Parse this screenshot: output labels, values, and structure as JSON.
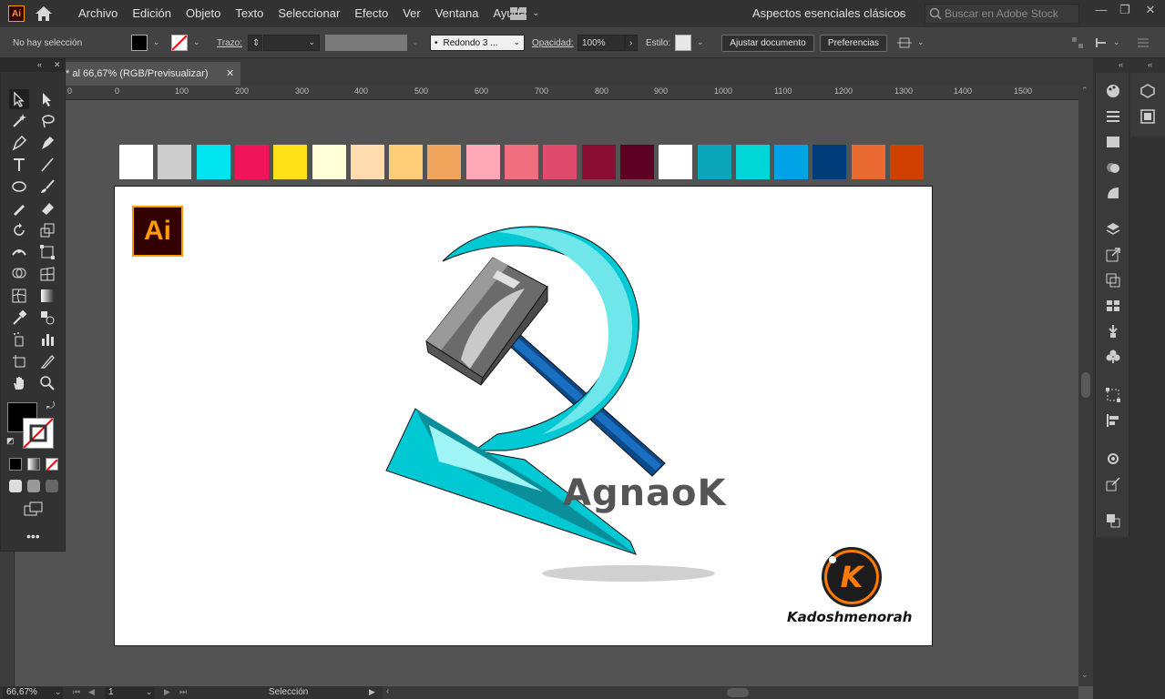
{
  "app": {
    "logo_text": "Ai",
    "menus": [
      "Archivo",
      "Edición",
      "Objeto",
      "Texto",
      "Seleccionar",
      "Efecto",
      "Ver",
      "Ventana",
      "Ayuda"
    ],
    "workspace": "Aspectos esenciales clásicos",
    "search_placeholder": "Buscar en Adobe Stock"
  },
  "control_bar": {
    "selection": "No hay selección",
    "stroke_label": "Trazo:",
    "brush_value": "Redondo 3 ...",
    "opacity_label": "Opacidad:",
    "opacity_value": "100%",
    "style_label": "Estilo:",
    "adjust_doc": "Ajustar documento",
    "preferences": "Preferencias"
  },
  "document": {
    "tab_title": "* al 66,67% (RGB/Previsualizar)",
    "tab_close": "✕"
  },
  "ruler_ticks": [
    "0",
    "0",
    "100",
    "200",
    "300",
    "400",
    "500",
    "600",
    "700",
    "800",
    "900",
    "1000",
    "1100",
    "1200",
    "1300",
    "1400",
    "1500"
  ],
  "status": {
    "zoom": "66,67%",
    "page": "1",
    "tool": "Selección"
  },
  "swatches": [
    "#ffffff",
    "#cccccc",
    "#00e5f0",
    "#f0145a",
    "#ffe21a",
    "#ffffd8",
    "#ffdcb0",
    "#ffcd78",
    "#f0a55c",
    "#ffa8b8",
    "#f06e7e",
    "#e04a6c",
    "#880e34",
    "#5c0024",
    "#ffffff",
    "#0aa5b8",
    "#00d6d6",
    "#00a4e6",
    "#003c78",
    "#eb6a32",
    "#d24000"
  ],
  "artboard": {
    "badge_text": "Ai",
    "wordmark": "AgnaoK",
    "brand_letter": "K",
    "brand_name": "Kadoshmenorah"
  }
}
